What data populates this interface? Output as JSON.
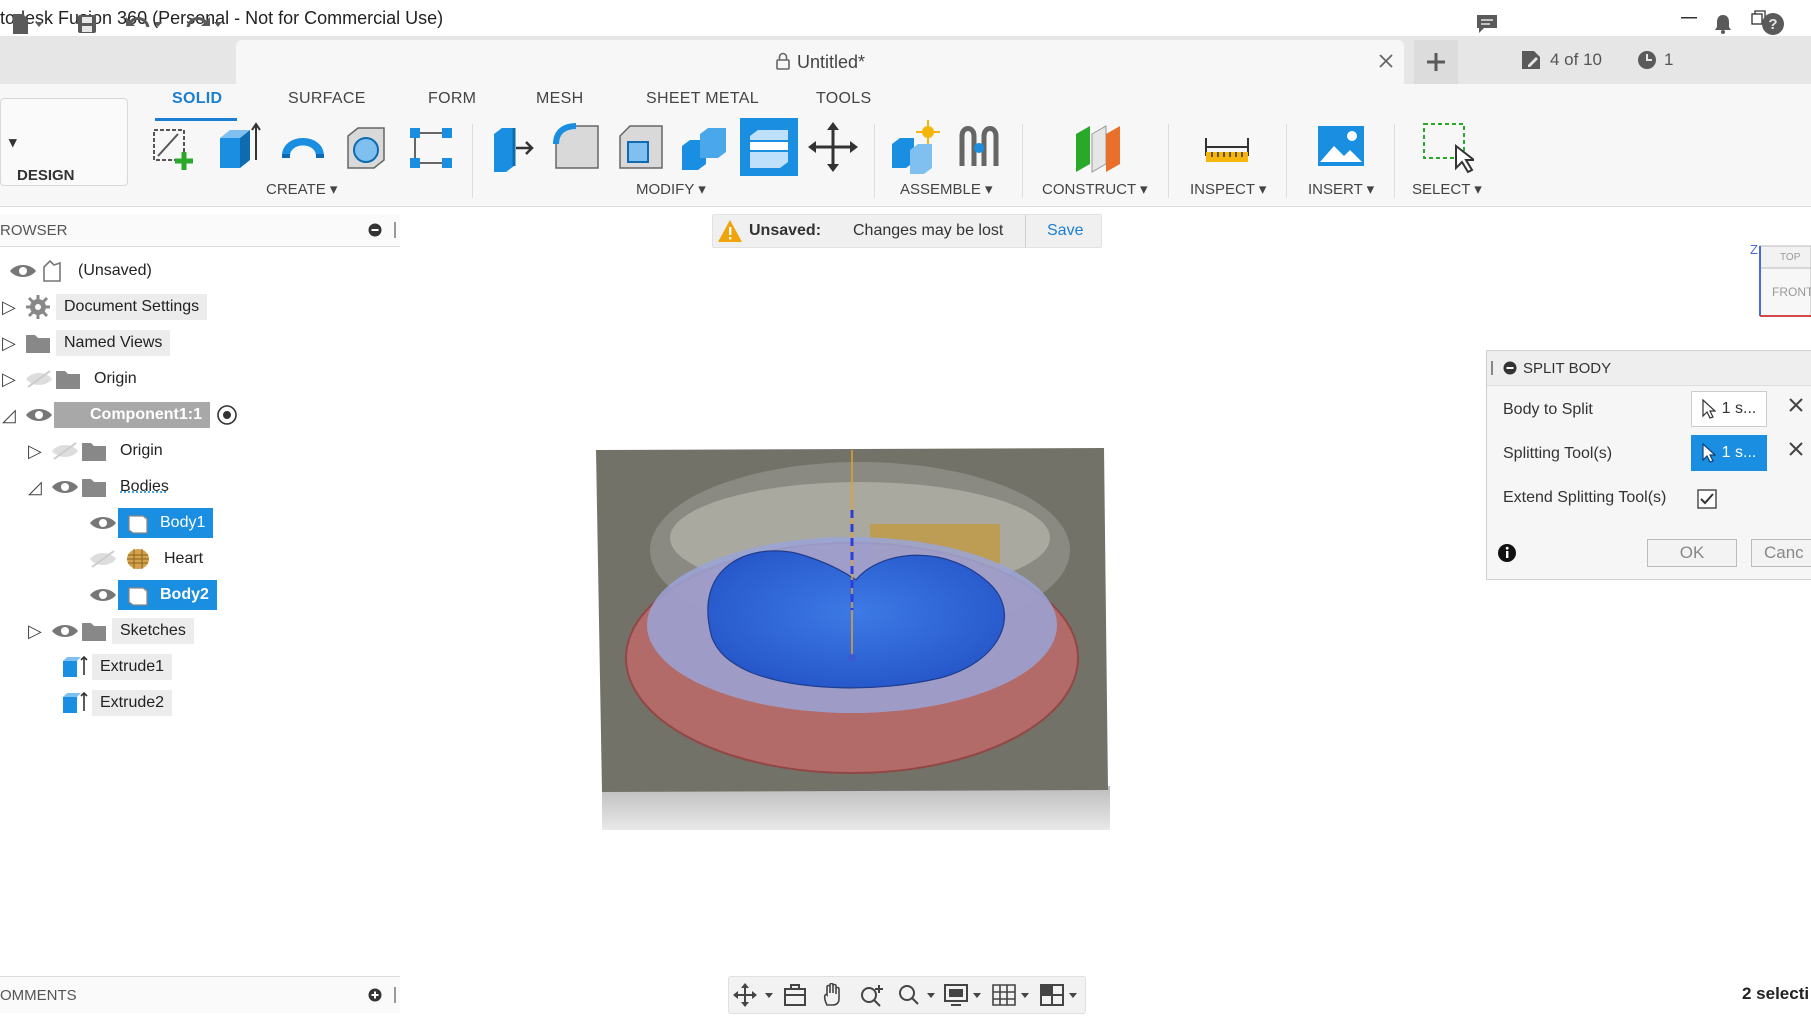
{
  "window": {
    "title": "todesk Fusion 360 (Personal - Not for Commercial Use)",
    "minimize_icon": "minimize-icon",
    "restore_icon": "restore-icon"
  },
  "doc_tab": {
    "title": "Untitled*"
  },
  "status": {
    "version": "4 of 10",
    "jobs": "1"
  },
  "ribbon": {
    "workspace": "DESIGN",
    "tabs": [
      "SOLID",
      "SURFACE",
      "FORM",
      "MESH",
      "SHEET METAL",
      "TOOLS"
    ],
    "active_tab": "SOLID",
    "groups": [
      "CREATE",
      "MODIFY",
      "ASSEMBLE",
      "CONSTRUCT",
      "INSPECT",
      "INSERT",
      "SELECT"
    ]
  },
  "browser": {
    "title": "ROWSER",
    "nodes": {
      "root": "(Unsaved)",
      "doc_settings": "Document Settings",
      "named_views": "Named Views",
      "origin": "Origin",
      "component": "Component1:1",
      "comp_origin": "Origin",
      "bodies": "Bodies",
      "body1": "Body1",
      "heart": "Heart",
      "body2": "Body2",
      "sketches": "Sketches",
      "extrude1": "Extrude1",
      "extrude2": "Extrude2"
    }
  },
  "unsaved": {
    "label": "Unsaved:",
    "message": "Changes may be lost",
    "save": "Save"
  },
  "split_body": {
    "title": "SPLIT BODY",
    "body_to_split_label": "Body to Split",
    "body_to_split_value": "1 s...",
    "splitting_tools_label": "Splitting Tool(s)",
    "splitting_tools_value": "1 s...",
    "extend_label": "Extend Splitting Tool(s)",
    "extend_checked": true,
    "ok": "OK",
    "cancel": "Canc"
  },
  "viewcube": {
    "top": "TOP",
    "front": "FRONT",
    "axis": "Z"
  },
  "comments": {
    "title": "OMMENTS"
  },
  "selection_status": "2 selecti",
  "colors": {
    "accent": "#1a8ee0",
    "ribbon_bg": "#f7f7f7",
    "warning": "#f0a30a"
  }
}
